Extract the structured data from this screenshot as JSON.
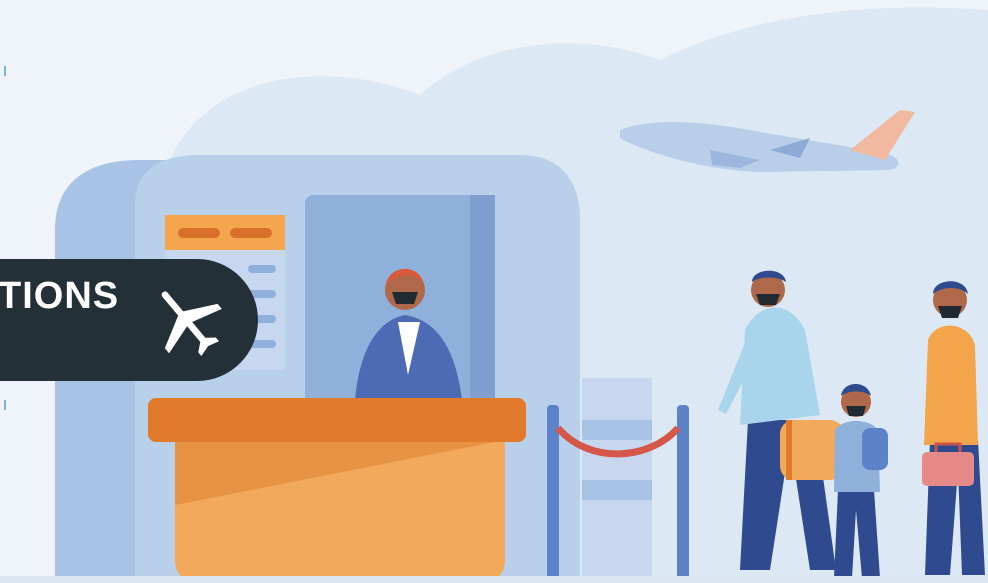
{
  "banner": {
    "text": "TIONS",
    "icon": "airplane-icon"
  },
  "colors": {
    "sky": "#eef4fa",
    "cloud": "#dce8f4",
    "kiosk": "#b9d0ea",
    "kiosk_dark": "#8fb0db",
    "desk_top": "#e27a2c",
    "desk_front": "#f3a95c",
    "banner_bg": "#233038",
    "traveler_shirt": "#a9d5ec",
    "traveler_pants": "#2f4a8e",
    "orange_person": "#f2a54a",
    "skin": "#b0684a"
  }
}
